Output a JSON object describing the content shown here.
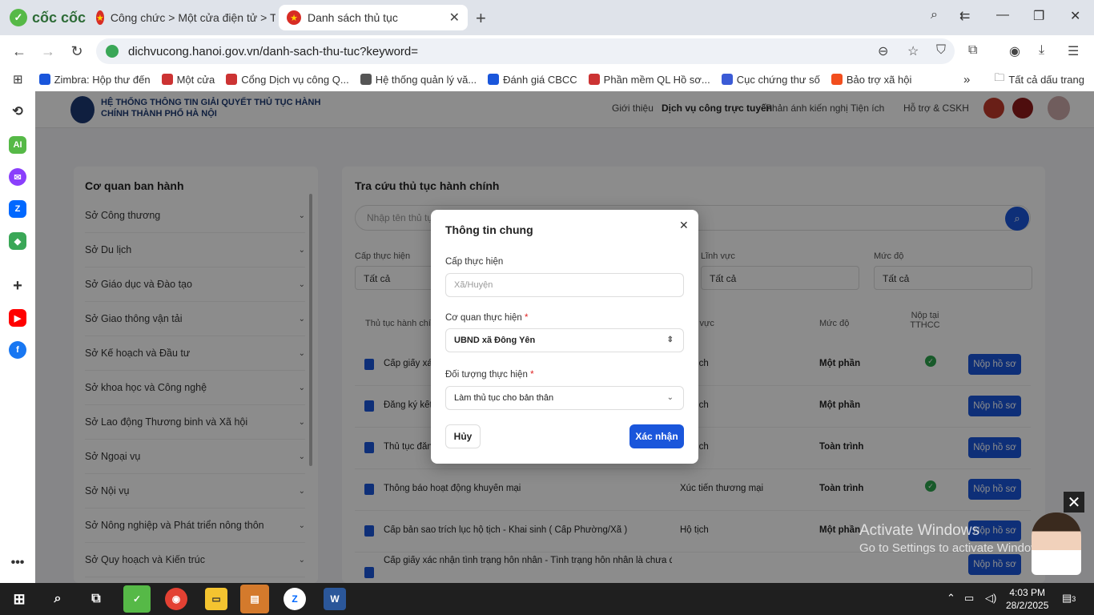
{
  "browser": {
    "brand": "cốc cốc",
    "tabs": [
      {
        "label": "Công chức > Một cửa điện tử > Tr"
      },
      {
        "label": "Danh sách thủ tục"
      }
    ],
    "url": "dichvucong.hanoi.gov.vn/danh-sach-thu-tuc?keyword=",
    "bookmarks": [
      "Zimbra: Hộp thư đến",
      "Một cửa",
      "Cổng Dịch vụ công Q...",
      "Hệ thống quản lý vă...",
      "Đánh giá CBCC",
      "Phần mềm QL Hồ sơ...",
      "Cục chứng thư số",
      "Bảo trợ xã hội"
    ],
    "all_bookmarks": "Tất cả dấu trang"
  },
  "site": {
    "title": "HỆ THỐNG THÔNG TIN GIẢI QUYẾT THỦ TỤC HÀNH CHÍNH THÀNH PHỐ HÀ NỘI",
    "nav": [
      "Giới thiệu",
      "Dịch vụ công trực tuyến",
      "Phản ánh kiến nghị",
      "Tiện ích",
      "Hỗ trợ & CSKH"
    ]
  },
  "sidebar": {
    "heading": "Cơ quan ban hành",
    "items": [
      "Sở Công thương",
      "Sở Du lịch",
      "Sở Giáo dục và Đào tạo",
      "Sở Giao thông vận tải",
      "Sở Kế hoạch và Đầu tư",
      "Sở khoa học và Công nghệ",
      "Sở Lao động Thương binh và Xã hội",
      "Sở Ngoại vụ",
      "Sở Nội vụ",
      "Sở Nông nghiệp và Phát triển nông thôn",
      "Sở Quy hoạch và Kiến trúc"
    ]
  },
  "main": {
    "heading": "Tra cứu thủ tục hành chính",
    "search_placeholder": "Nhập tên thủ tục",
    "filters": [
      {
        "label": "Cấp thực hiện",
        "value": "Tất cả"
      },
      {
        "label": "Lĩnh vực",
        "value": "Tất cả"
      },
      {
        "label": "Mức độ",
        "value": "Tất cả"
      }
    ],
    "columns": [
      "Thủ tục hành chính",
      "Lĩnh vực",
      "Mức độ",
      "Nộp tại TTHCC"
    ],
    "submit_label": "Nộp hồ sơ",
    "rows": [
      {
        "name": "Cấp giấy xác",
        "field": "Hộ tịch",
        "level": "Một phần",
        "tthcc": true
      },
      {
        "name": "Đăng ký kết",
        "field": "Hộ tịch",
        "level": "Một phần",
        "tthcc": false
      },
      {
        "name": "Thủ tục đăng",
        "field": "Hộ tịch",
        "level": "Toàn trình",
        "tthcc": false
      },
      {
        "name": "Thông báo hoạt động khuyến mại",
        "field": "Xúc tiến thương mại",
        "level": "Toàn trình",
        "tthcc": true
      },
      {
        "name": "Cấp bản sao trích lục hộ tịch - Khai sinh ( Cấp Phường/Xã )",
        "field": "Hộ tịch",
        "level": "Một phần",
        "tthcc": false
      },
      {
        "name": "Cấp giấy xác nhận tình trạng hôn nhân - Tình trạng hôn nhân là chưa đăng",
        "field": "",
        "level": "",
        "tthcc": false
      }
    ]
  },
  "modal": {
    "title": "Thông tin chung",
    "level_label": "Cấp thực hiện",
    "level_placeholder": "Xã/Huyện",
    "agency_label": "Cơ quan thực hiện",
    "agency_value": "UBND xã Đông Yên",
    "subject_label": "Đối tượng thực hiện",
    "subject_value": "Làm thủ tục cho bản thân",
    "required_mark": "*",
    "cancel": "Hủy",
    "confirm": "Xác nhận"
  },
  "watermark": {
    "line1": "Activate Windows",
    "line2": "Go to Settings to activate Windows."
  },
  "taskbar": {
    "time": "4:03 PM",
    "date": "28/2/2025",
    "notif_count": "3"
  },
  "colors": {
    "primary": "#1a56db",
    "danger": "#e02424",
    "success": "#2da44e"
  }
}
